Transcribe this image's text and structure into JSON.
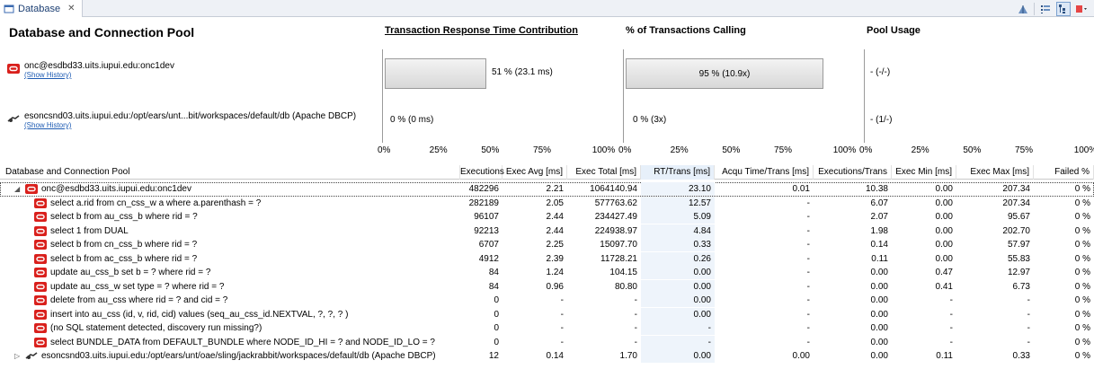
{
  "tab": {
    "label": "Database",
    "close": "✕"
  },
  "header": {
    "title": "Database and Connection Pool",
    "col_rt": "Transaction Response Time Contribution",
    "col_pct": "% of Transactions Calling",
    "col_pool": "Pool Usage"
  },
  "pools": [
    {
      "name": "onc@esdbd33.uits.iupui.edu:onc1dev",
      "link": "(Show History)",
      "rt_pct": 51,
      "rt_label": "51 % (23.1 ms)",
      "calling_pct": 95,
      "calling_label": "95 % (10.9x)",
      "pool_label": "- (-/-)"
    },
    {
      "name": "esoncsnd03.uits.iupui.edu:/opt/ears/unt...bit/workspaces/default/db (Apache DBCP)",
      "link": "(Show History)",
      "rt_pct": 0,
      "rt_label": "0 % (0 ms)",
      "calling_pct": 0,
      "calling_label": "0 % (3x)",
      "pool_label": "- (1/-)"
    }
  ],
  "axis_ticks": [
    "0%",
    "25%",
    "50%",
    "75%",
    "100%"
  ],
  "columns": [
    "Database and Connection Pool",
    "Executions",
    "Exec Avg [ms]",
    "Exec Total [ms]",
    "RT/Trans [ms]",
    "Acqu Time/Trans [ms]",
    "Executions/Trans",
    "Exec Min [ms]",
    "Exec Max [ms]",
    "Failed %"
  ],
  "rows": [
    {
      "level": 0,
      "arrow": "◢",
      "name": "onc@esdbd33.uits.iupui.edu:onc1dev",
      "icon": "oracle",
      "vals": [
        "482296",
        "2.21",
        "1064140.94",
        "23.10",
        "0.01",
        "10.38",
        "0.00",
        "207.34",
        "0 %"
      ]
    },
    {
      "level": 1,
      "name": "select a.rid from cn_css_w a where a.parenthash = ?",
      "icon": "oracle",
      "vals": [
        "282189",
        "2.05",
        "577763.62",
        "12.57",
        "-",
        "6.07",
        "0.00",
        "207.34",
        "0 %"
      ]
    },
    {
      "level": 1,
      "name": "select b from au_css_b where rid = ?",
      "icon": "oracle",
      "vals": [
        "96107",
        "2.44",
        "234427.49",
        "5.09",
        "-",
        "2.07",
        "0.00",
        "95.67",
        "0 %"
      ]
    },
    {
      "level": 1,
      "name": "select 1 from DUAL",
      "icon": "oracle",
      "vals": [
        "92213",
        "2.44",
        "224938.97",
        "4.84",
        "-",
        "1.98",
        "0.00",
        "202.70",
        "0 %"
      ]
    },
    {
      "level": 1,
      "name": "select b from cn_css_b where rid = ?",
      "icon": "oracle",
      "vals": [
        "6707",
        "2.25",
        "15097.70",
        "0.33",
        "-",
        "0.14",
        "0.00",
        "57.97",
        "0 %"
      ]
    },
    {
      "level": 1,
      "name": "select b from ac_css_b where rid = ?",
      "icon": "oracle",
      "vals": [
        "4912",
        "2.39",
        "11728.21",
        "0.26",
        "-",
        "0.11",
        "0.00",
        "55.83",
        "0 %"
      ]
    },
    {
      "level": 1,
      "name": "update au_css_b set b = ? where rid = ?",
      "icon": "oracle",
      "vals": [
        "84",
        "1.24",
        "104.15",
        "0.00",
        "-",
        "0.00",
        "0.47",
        "12.97",
        "0 %"
      ]
    },
    {
      "level": 1,
      "name": "update au_css_w set  type = ? where rid = ?",
      "icon": "oracle",
      "vals": [
        "84",
        "0.96",
        "80.80",
        "0.00",
        "-",
        "0.00",
        "0.41",
        "6.73",
        "0 %"
      ]
    },
    {
      "level": 1,
      "name": "delete from au_css where rid = ? and cid = ?",
      "icon": "oracle",
      "vals": [
        "0",
        "-",
        "-",
        "0.00",
        "-",
        "0.00",
        "-",
        "-",
        "0 %"
      ]
    },
    {
      "level": 1,
      "name": "insert into au_css (id, v, rid, cid) values (seq_au_css_id.NEXTVAL, ?, ?, ? )",
      "icon": "oracle",
      "vals": [
        "0",
        "-",
        "-",
        "0.00",
        "-",
        "0.00",
        "-",
        "-",
        "0 %"
      ]
    },
    {
      "level": 1,
      "name": "(no SQL statement detected, discovery run missing?)",
      "icon": "oracle",
      "vals": [
        "0",
        "-",
        "-",
        "-",
        "-",
        "0.00",
        "-",
        "-",
        "0 %"
      ]
    },
    {
      "level": 1,
      "name": "select BUNDLE_DATA from DEFAULT_BUNDLE where NODE_ID_HI = ? and NODE_ID_LO = ?",
      "icon": "oracle",
      "vals": [
        "0",
        "-",
        "-",
        "-",
        "-",
        "0.00",
        "-",
        "-",
        "0 %"
      ]
    },
    {
      "level": 0,
      "arrow": "▷",
      "name": "esoncsnd03.uits.iupui.edu:/opt/ears/unt/oae/sling/jackrabbit/workspaces/default/db (Apache DBCP)",
      "icon": "dbcp",
      "vals": [
        "12",
        "0.14",
        "1.70",
        "0.00",
        "0.00",
        "0.00",
        "0.11",
        "0.33",
        "0 %"
      ]
    }
  ]
}
